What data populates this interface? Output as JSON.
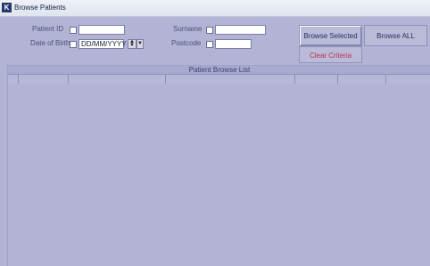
{
  "window": {
    "title": "Browse Patients",
    "icon": "app-icon"
  },
  "criteria": {
    "patient_id_label": "Patient ID",
    "dob_label": "Date of Birth",
    "dob_value": "DD/MM/YYYY",
    "surname_label": "Surname",
    "postcode_label": "Postcode"
  },
  "buttons": {
    "browse_selected": "Browse Selected",
    "browse_all": "Browse ALL",
    "clear_criteria": "Clear Criteria"
  },
  "list": {
    "title": "Patient Browse List"
  },
  "colors": {
    "background": "#b3b3d6",
    "accent": "#c0304a"
  }
}
